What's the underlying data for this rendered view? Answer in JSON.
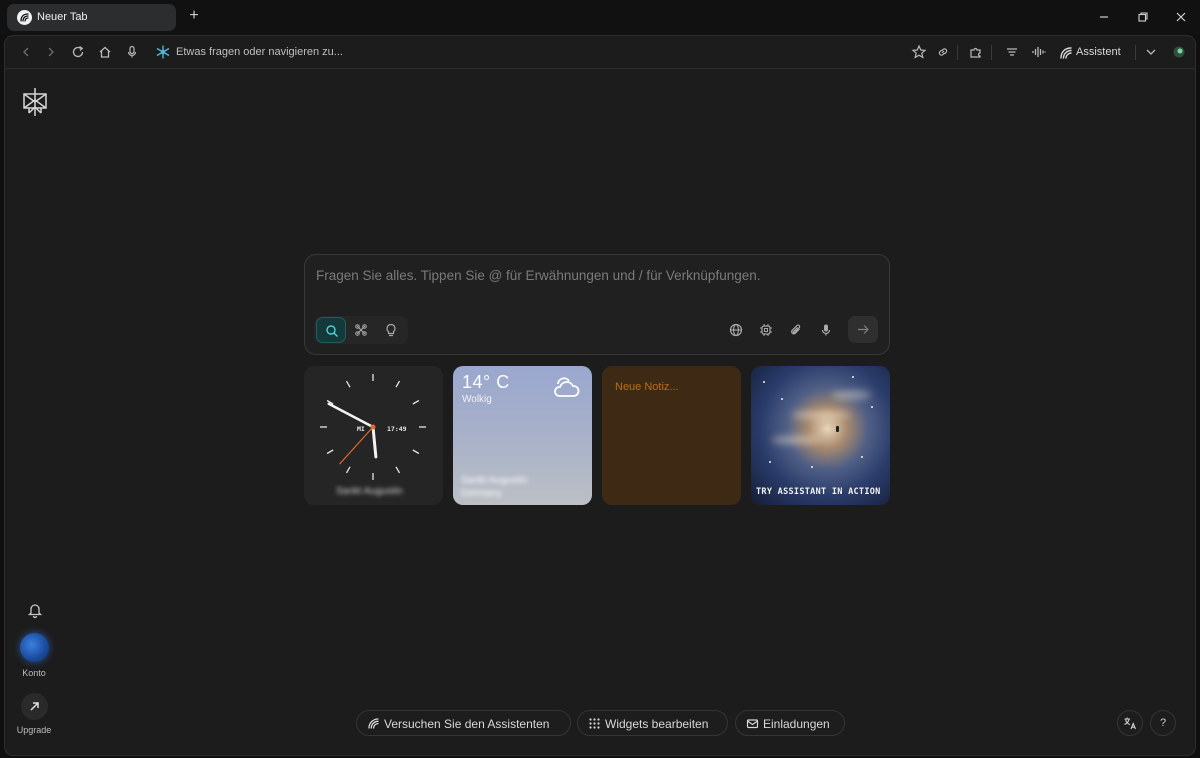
{
  "tab": {
    "title": "Neuer Tab",
    "new_tab_label": "+"
  },
  "toolbar": {
    "omnibox_text": "Etwas fragen oder navigieren zu...",
    "assistant_label": "Assistent"
  },
  "rail": {
    "account_label": "Konto",
    "upgrade_label": "Upgrade"
  },
  "search": {
    "placeholder": "Fragen Sie alles. Tippen Sie @ für Erwähnungen und / für Verknüpfungen.",
    "active_mode": "search"
  },
  "widgets": {
    "clock": {
      "time": "17:49",
      "day": "MI",
      "location": "Sankt Augustin",
      "hour": 17,
      "minute": 49,
      "second": 37
    },
    "weather": {
      "temp": "14° C",
      "condition": "Wolkig",
      "location": "Sankt Augustin",
      "region": "Germany"
    },
    "note": {
      "placeholder": "Neue Notiz..."
    },
    "promo": {
      "label": "TRY ASSISTANT IN ACTION"
    }
  },
  "bottom": {
    "try_assistant": "Versuchen Sie den Assistenten",
    "edit_widgets": "Widgets bearbeiten",
    "invitations": "Einladungen",
    "help": "?"
  },
  "colors": {
    "accent": "#4fd1d6",
    "note_bg": "#3e2a14",
    "note_text": "#b66e16",
    "second_hand": "#e26a2c"
  }
}
